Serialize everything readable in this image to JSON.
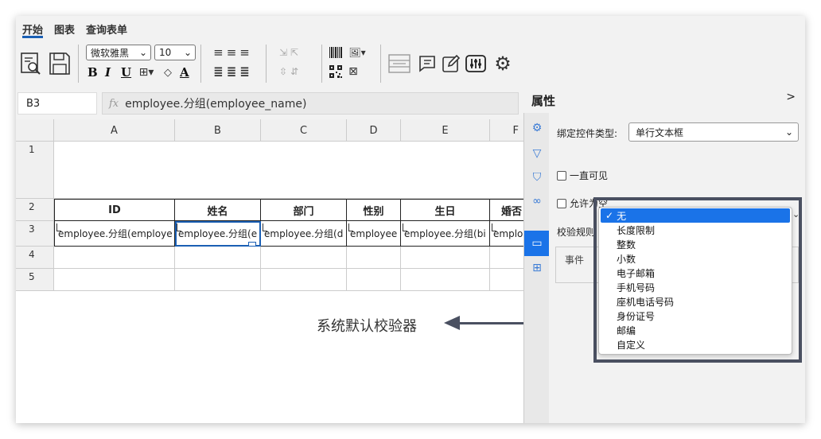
{
  "menu": {
    "tabs": [
      "开始",
      "图表",
      "查询表单"
    ]
  },
  "toolbar": {
    "font": "微软雅黑",
    "size": "10",
    "bold": "B",
    "italic": "I",
    "underline": "U",
    "font_color": "A",
    "icons": [
      "preview-icon",
      "save-icon",
      "align-icons",
      "barcode-icon",
      "image-icon",
      "qrcode-icon",
      "merge-icon",
      "form-icon",
      "edit-icon",
      "settings-sliders-icon",
      "gear-icon"
    ]
  },
  "formula_bar": {
    "cell_ref": "B3",
    "fx": "fx",
    "formula": "employee.分组(employee_name)"
  },
  "grid": {
    "columns": [
      "A",
      "B",
      "C",
      "D",
      "E",
      "F"
    ],
    "rows": [
      "1",
      "2",
      "3",
      "4",
      "5"
    ],
    "header_row": [
      "ID",
      "姓名",
      "部门",
      "性别",
      "生日",
      "婚否"
    ],
    "data_row": [
      "employee.分组(employe",
      "employee.分组(e",
      "employee.分组(d",
      "employee",
      "employee.分组(bi",
      "emplo"
    ]
  },
  "annotation": {
    "text": "系统默认校验器"
  },
  "properties": {
    "title": "属性",
    "collapse": ">",
    "control_type_label": "绑定控件类型:",
    "control_type_value": "单行文本框",
    "always_visible": "一直可见",
    "allow_empty": "允许为空",
    "validation_label": "校验规则",
    "events_label": "事件"
  },
  "validation_options": {
    "selected": "无",
    "items": [
      "长度限制",
      "整数",
      "小数",
      "电子邮箱",
      "手机号码",
      "座机电话号码",
      "身份证号",
      "邮编",
      "自定义"
    ]
  },
  "colors": {
    "accent": "#1a73e8",
    "annotation": "#4a5061"
  }
}
